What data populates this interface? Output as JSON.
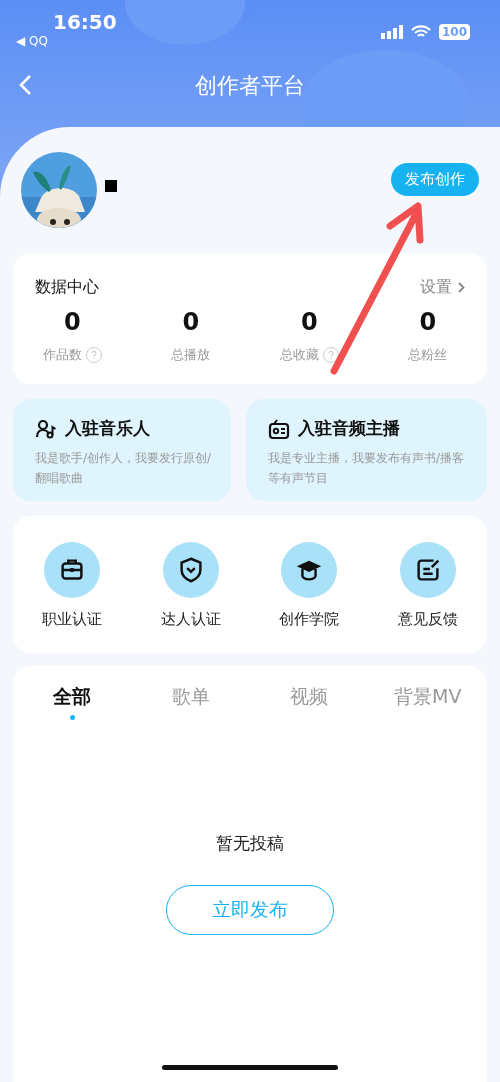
{
  "status_bar": {
    "time": "16:50",
    "back_app": "◀ QQ",
    "battery": "100"
  },
  "nav": {
    "title": "创作者平台"
  },
  "profile": {
    "publish_button": "发布创作"
  },
  "data_center": {
    "title": "数据中心",
    "settings_link": "设置",
    "stats": [
      {
        "value": "0",
        "label": "作品数",
        "help": true
      },
      {
        "value": "0",
        "label": "总播放",
        "help": false
      },
      {
        "value": "0",
        "label": "总收藏",
        "help": true
      },
      {
        "value": "0",
        "label": "总粉丝",
        "help": false
      }
    ]
  },
  "join_cards": [
    {
      "kind": "musician",
      "title": "入驻音乐人",
      "description": "我是歌手/创作人，我要发行原创/翻唱歌曲"
    },
    {
      "kind": "podcaster",
      "title": "入驻音频主播",
      "description": "我是专业主播，我要发布有声书/播客等有声节目"
    }
  ],
  "shortcuts": [
    {
      "kind": "briefcase",
      "label": "职业认证"
    },
    {
      "kind": "shield",
      "label": "达人认证"
    },
    {
      "kind": "cap",
      "label": "创作学院"
    },
    {
      "kind": "feedback",
      "label": "意见反馈"
    }
  ],
  "tabs": [
    {
      "label": "全部",
      "selected": true
    },
    {
      "label": "歌单",
      "selected": false
    },
    {
      "label": "视频",
      "selected": false
    },
    {
      "label": "背景MV",
      "selected": false
    }
  ],
  "empty_state": {
    "message": "暂无投稿",
    "action_button": "立即发布"
  }
}
